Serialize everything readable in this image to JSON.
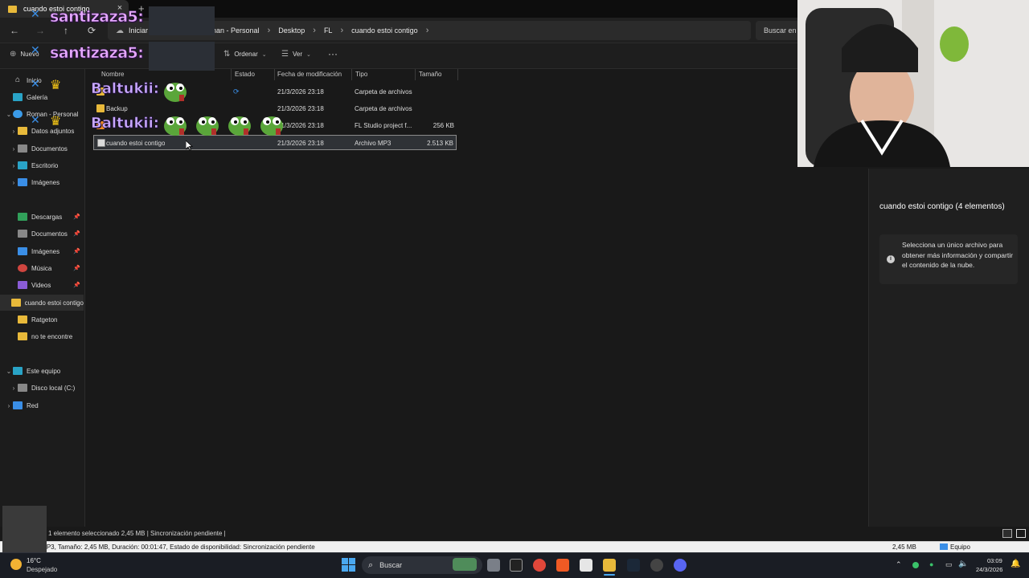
{
  "window": {
    "tab_title": "cuando estoi contigo",
    "tab_close": "×",
    "new_tab": "+"
  },
  "nav": {
    "back": "←",
    "forward": "→",
    "up": "↑",
    "refresh": "⟳",
    "breadcrumbs": [
      "Iniciar",
      "nan - Personal",
      "Desktop",
      "FL",
      "cuando estoi contigo"
    ],
    "search_placeholder": "Buscar en"
  },
  "toolbar": {
    "new_label": "Nuevo",
    "sort_label": "Ordenar",
    "view_label": "Ver",
    "more": "···"
  },
  "sidebar": {
    "items": [
      {
        "label": "Inicio",
        "icon": "home-icon"
      },
      {
        "label": "Galería",
        "icon": "gallery-icon"
      },
      {
        "label": "Roman - Personal",
        "icon": "cloud-icon"
      },
      {
        "label": "Datos adjuntos",
        "icon": "folder-icon"
      },
      {
        "label": "Documentos",
        "icon": "documents-icon"
      },
      {
        "label": "Escritorio",
        "icon": "desktop-icon"
      },
      {
        "label": "Imágenes",
        "icon": "pictures-icon"
      },
      {
        "label": "Descargas",
        "icon": "downloads-icon"
      },
      {
        "label": "Documentos",
        "icon": "documents-icon"
      },
      {
        "label": "Imágenes",
        "icon": "pictures-icon"
      },
      {
        "label": "Música",
        "icon": "music-icon"
      },
      {
        "label": "Videos",
        "icon": "videos-icon"
      },
      {
        "label": "cuando estoi contigo",
        "icon": "folder-icon"
      },
      {
        "label": "Ratgeton",
        "icon": "folder-icon"
      },
      {
        "label": "no te encontre",
        "icon": "folder-icon"
      },
      {
        "label": "Este equipo",
        "icon": "pc-icon"
      },
      {
        "label": "Disco local (C:)",
        "icon": "drive-icon"
      },
      {
        "label": "Red",
        "icon": "network-icon"
      }
    ]
  },
  "columns": {
    "name": "Nombre",
    "status": "Estado",
    "modified": "Fecha de modificación",
    "type": "Tipo",
    "size": "Tamaño"
  },
  "files": [
    {
      "name": "",
      "date": "21/3/2026 23:18",
      "type": "Carpeta de archivos",
      "size": ""
    },
    {
      "name": "Backup",
      "date": "21/3/2026 23:18",
      "type": "Carpeta de archivos",
      "size": ""
    },
    {
      "name": "",
      "date": "21/3/2026 23:18",
      "type": "FL Studio project f...",
      "size": "256 KB"
    },
    {
      "name": "cuando estoi contigo",
      "date": "21/3/2026 23:18",
      "type": "Archivo MP3",
      "size": "2.513 KB"
    }
  ],
  "details": {
    "title": "cuando estoi contigo (4 elementos)",
    "message": "Selecciona un único archivo para obtener más información y compartir el contenido de la nube.",
    "info": "i"
  },
  "status": {
    "text": "1 elemento seleccionado  2,45 MB  |  Sincronización pendiente  |"
  },
  "infobar": {
    "text": "Tipo: Archivo MP3, Tamaño: 2,45 MB, Duración: 00:01:47, Estado de disponibilidad: Sincronización pendiente",
    "size": "2,45 MB",
    "computer": "Equipo"
  },
  "taskbar": {
    "temp": "16°C",
    "weather": "Despejado",
    "search": "Buscar",
    "time": "03:09",
    "date": "24/3/2026"
  },
  "overlay": {
    "user1": "santizaza5:",
    "user2": "Baltukii:"
  }
}
